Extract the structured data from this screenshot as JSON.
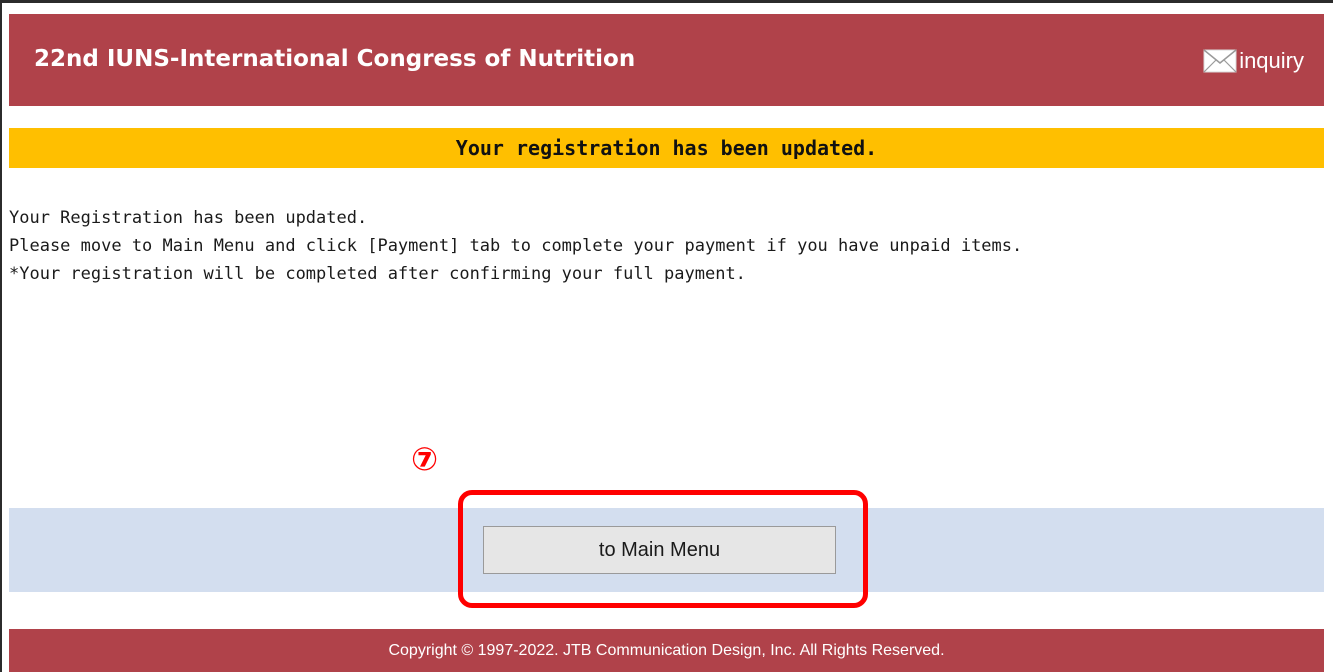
{
  "header": {
    "title": "22nd IUNS-International Congress of Nutrition",
    "inquiry_label": "inquiry"
  },
  "banner": {
    "text": "Your registration has been updated."
  },
  "message": {
    "lines": [
      "Your Registration has been updated.",
      "Please move to Main Menu and click [Payment] tab to complete your payment if you have unpaid items.",
      "*Your registration will be completed after confirming your full payment."
    ]
  },
  "annotation": {
    "step_marker": "⑦"
  },
  "actions": {
    "main_menu_label": "to Main Menu"
  },
  "footer": {
    "copyright": "Copyright © 1997-2022. JTB Communication Design, Inc. All Rights Reserved."
  },
  "colors": {
    "header_bg": "#b0424a",
    "banner_bg": "#ffbf00",
    "button_bar_bg": "#d3deef",
    "highlight": "#ff0000"
  },
  "icons": {
    "inquiry": "envelope-icon"
  }
}
